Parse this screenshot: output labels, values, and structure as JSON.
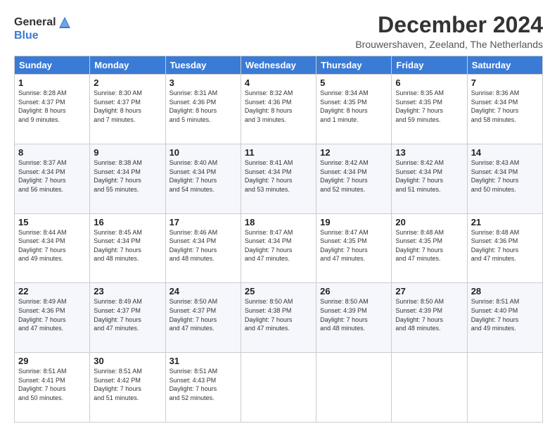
{
  "logo": {
    "general": "General",
    "blue": "Blue"
  },
  "header": {
    "month_title": "December 2024",
    "subtitle": "Brouwershaven, Zeeland, The Netherlands"
  },
  "weekdays": [
    "Sunday",
    "Monday",
    "Tuesday",
    "Wednesday",
    "Thursday",
    "Friday",
    "Saturday"
  ],
  "weeks": [
    [
      {
        "day": "1",
        "info": "Sunrise: 8:28 AM\nSunset: 4:37 PM\nDaylight: 8 hours\nand 9 minutes."
      },
      {
        "day": "2",
        "info": "Sunrise: 8:30 AM\nSunset: 4:37 PM\nDaylight: 8 hours\nand 7 minutes."
      },
      {
        "day": "3",
        "info": "Sunrise: 8:31 AM\nSunset: 4:36 PM\nDaylight: 8 hours\nand 5 minutes."
      },
      {
        "day": "4",
        "info": "Sunrise: 8:32 AM\nSunset: 4:36 PM\nDaylight: 8 hours\nand 3 minutes."
      },
      {
        "day": "5",
        "info": "Sunrise: 8:34 AM\nSunset: 4:35 PM\nDaylight: 8 hours\nand 1 minute."
      },
      {
        "day": "6",
        "info": "Sunrise: 8:35 AM\nSunset: 4:35 PM\nDaylight: 7 hours\nand 59 minutes."
      },
      {
        "day": "7",
        "info": "Sunrise: 8:36 AM\nSunset: 4:34 PM\nDaylight: 7 hours\nand 58 minutes."
      }
    ],
    [
      {
        "day": "8",
        "info": "Sunrise: 8:37 AM\nSunset: 4:34 PM\nDaylight: 7 hours\nand 56 minutes."
      },
      {
        "day": "9",
        "info": "Sunrise: 8:38 AM\nSunset: 4:34 PM\nDaylight: 7 hours\nand 55 minutes."
      },
      {
        "day": "10",
        "info": "Sunrise: 8:40 AM\nSunset: 4:34 PM\nDaylight: 7 hours\nand 54 minutes."
      },
      {
        "day": "11",
        "info": "Sunrise: 8:41 AM\nSunset: 4:34 PM\nDaylight: 7 hours\nand 53 minutes."
      },
      {
        "day": "12",
        "info": "Sunrise: 8:42 AM\nSunset: 4:34 PM\nDaylight: 7 hours\nand 52 minutes."
      },
      {
        "day": "13",
        "info": "Sunrise: 8:42 AM\nSunset: 4:34 PM\nDaylight: 7 hours\nand 51 minutes."
      },
      {
        "day": "14",
        "info": "Sunrise: 8:43 AM\nSunset: 4:34 PM\nDaylight: 7 hours\nand 50 minutes."
      }
    ],
    [
      {
        "day": "15",
        "info": "Sunrise: 8:44 AM\nSunset: 4:34 PM\nDaylight: 7 hours\nand 49 minutes."
      },
      {
        "day": "16",
        "info": "Sunrise: 8:45 AM\nSunset: 4:34 PM\nDaylight: 7 hours\nand 48 minutes."
      },
      {
        "day": "17",
        "info": "Sunrise: 8:46 AM\nSunset: 4:34 PM\nDaylight: 7 hours\nand 48 minutes."
      },
      {
        "day": "18",
        "info": "Sunrise: 8:47 AM\nSunset: 4:34 PM\nDaylight: 7 hours\nand 47 minutes."
      },
      {
        "day": "19",
        "info": "Sunrise: 8:47 AM\nSunset: 4:35 PM\nDaylight: 7 hours\nand 47 minutes."
      },
      {
        "day": "20",
        "info": "Sunrise: 8:48 AM\nSunset: 4:35 PM\nDaylight: 7 hours\nand 47 minutes."
      },
      {
        "day": "21",
        "info": "Sunrise: 8:48 AM\nSunset: 4:36 PM\nDaylight: 7 hours\nand 47 minutes."
      }
    ],
    [
      {
        "day": "22",
        "info": "Sunrise: 8:49 AM\nSunset: 4:36 PM\nDaylight: 7 hours\nand 47 minutes."
      },
      {
        "day": "23",
        "info": "Sunrise: 8:49 AM\nSunset: 4:37 PM\nDaylight: 7 hours\nand 47 minutes."
      },
      {
        "day": "24",
        "info": "Sunrise: 8:50 AM\nSunset: 4:37 PM\nDaylight: 7 hours\nand 47 minutes."
      },
      {
        "day": "25",
        "info": "Sunrise: 8:50 AM\nSunset: 4:38 PM\nDaylight: 7 hours\nand 47 minutes."
      },
      {
        "day": "26",
        "info": "Sunrise: 8:50 AM\nSunset: 4:39 PM\nDaylight: 7 hours\nand 48 minutes."
      },
      {
        "day": "27",
        "info": "Sunrise: 8:50 AM\nSunset: 4:39 PM\nDaylight: 7 hours\nand 48 minutes."
      },
      {
        "day": "28",
        "info": "Sunrise: 8:51 AM\nSunset: 4:40 PM\nDaylight: 7 hours\nand 49 minutes."
      }
    ],
    [
      {
        "day": "29",
        "info": "Sunrise: 8:51 AM\nSunset: 4:41 PM\nDaylight: 7 hours\nand 50 minutes."
      },
      {
        "day": "30",
        "info": "Sunrise: 8:51 AM\nSunset: 4:42 PM\nDaylight: 7 hours\nand 51 minutes."
      },
      {
        "day": "31",
        "info": "Sunrise: 8:51 AM\nSunset: 4:43 PM\nDaylight: 7 hours\nand 52 minutes."
      },
      {
        "day": "",
        "info": ""
      },
      {
        "day": "",
        "info": ""
      },
      {
        "day": "",
        "info": ""
      },
      {
        "day": "",
        "info": ""
      }
    ]
  ]
}
